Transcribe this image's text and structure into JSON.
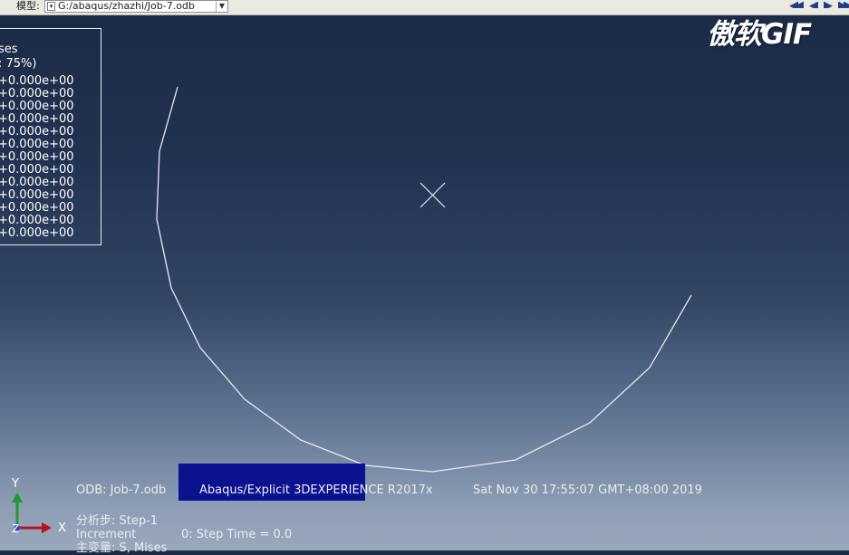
{
  "toolbar": {
    "model_label": "模型:",
    "model_path": "G:/abaqus/zhazhi/Job-7.odb"
  },
  "animation_controls": [
    "first-frame-icon",
    "previous-frame-icon",
    "next-frame-icon",
    "last-frame-icon"
  ],
  "legend": {
    "title": "ses",
    "subtitle": ": 75%)",
    "values": [
      "+0.000e+00",
      "+0.000e+00",
      "+0.000e+00",
      "+0.000e+00",
      "+0.000e+00",
      "+0.000e+00",
      "+0.000e+00",
      "+0.000e+00",
      "+0.000e+00",
      "+0.000e+00",
      "+0.000e+00",
      "+0.000e+00",
      "+0.000e+00"
    ]
  },
  "watermark": "傲软GIF",
  "info": {
    "odb": "ODB: Job-7.odb",
    "solver": "Abaqus/Explicit 3DEXPERIENCE R2017x",
    "datetime": "Sat Nov 30 17:55:07 GMT+08:00 2019",
    "step": "分析步: Step-1",
    "increment_label": "Increment",
    "increment_value": "0: Step Time =  0.0",
    "primary_var": "主变量: S, Mises"
  },
  "triad": {
    "y": "Y",
    "z": "Z",
    "x": "X"
  },
  "colors": {
    "background_top": "#1b2a45",
    "background_bottom": "#9aa8bc",
    "info_highlight": "#0c128f",
    "triad_y": "#1f9a2e",
    "triad_x": "#b01818",
    "triad_z": "#2b3fd0",
    "curve": "#e6eaf2"
  }
}
